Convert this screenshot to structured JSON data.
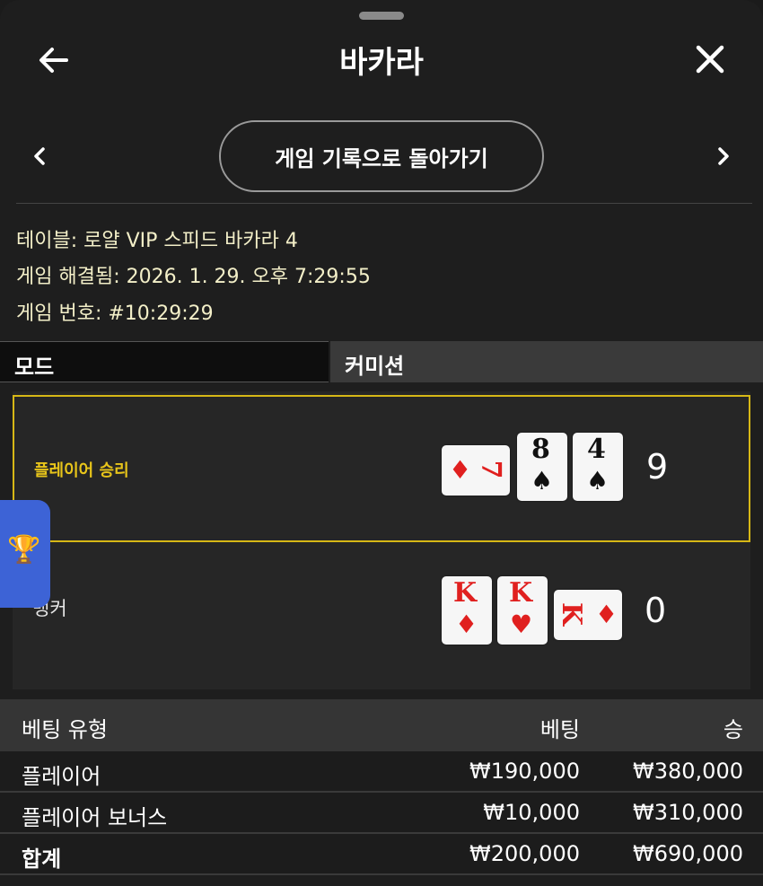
{
  "header": {
    "title": "바카라"
  },
  "nav": {
    "history_button": "게임 기록으로 돌아가기"
  },
  "info": {
    "table": "테이블: 로얄 VIP 스피드 바카라 4",
    "resolved": "게임 해결됨: 2026. 1. 29. 오후 7:29:55",
    "number": "게임 번호: #10:29:29"
  },
  "mode": {
    "mode_label": "모드",
    "commission_label": "커미션"
  },
  "result": {
    "player": {
      "label": "플레이어 승리",
      "total": "9",
      "cards": [
        {
          "rank": "7",
          "suit": "♦",
          "color": "red",
          "orientation": "horizontal"
        },
        {
          "rank": "8",
          "suit": "♠",
          "color": "black",
          "orientation": "vertical"
        },
        {
          "rank": "4",
          "suit": "♠",
          "color": "black",
          "orientation": "vertical"
        }
      ]
    },
    "banker": {
      "label": "뱅커",
      "total": "0",
      "cards": [
        {
          "rank": "K",
          "suit": "♦",
          "color": "red",
          "orientation": "vertical"
        },
        {
          "rank": "K",
          "suit": "♥",
          "color": "red",
          "orientation": "vertical"
        },
        {
          "rank": "K",
          "suit": "♦",
          "color": "red",
          "orientation": "horizontal"
        }
      ]
    }
  },
  "bets": {
    "headers": {
      "type": "베팅 유형",
      "bet": "베팅",
      "win": "승"
    },
    "rows": [
      {
        "type": "플레이어",
        "bet": "₩190,000",
        "win": "₩380,000"
      },
      {
        "type": "플레이어 보너스",
        "bet": "₩10,000",
        "win": "₩310,000"
      }
    ],
    "total": {
      "type": "합계",
      "bet": "₩200,000",
      "win": "₩690,000"
    }
  },
  "colors": {
    "player_win_accent": "#d6b716",
    "trophy_tab": "#3d63d6",
    "info_text": "#f3efc8"
  },
  "icons": {
    "back": "arrow-left-icon",
    "close": "close-icon",
    "prev": "chevron-left-icon",
    "next": "chevron-right-icon",
    "trophy": "trophy-icon"
  }
}
